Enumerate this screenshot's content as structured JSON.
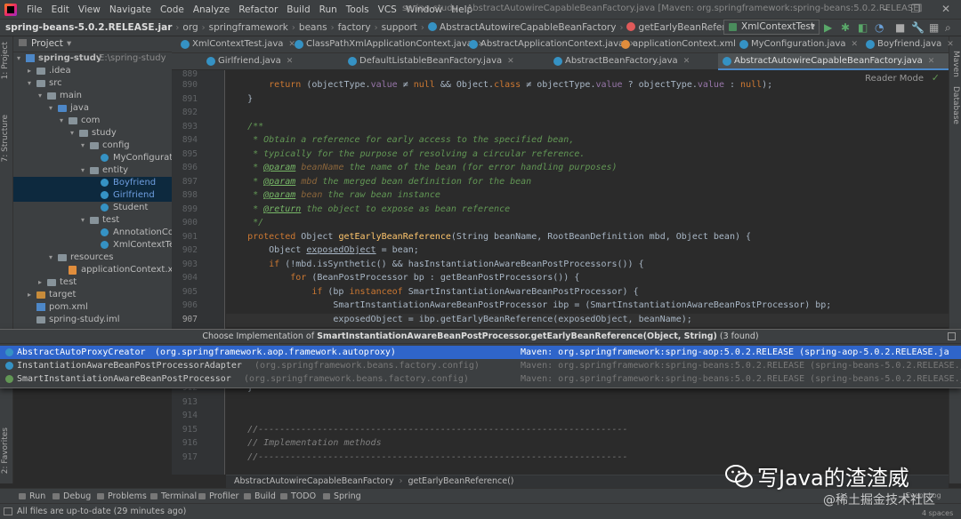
{
  "window": {
    "title": "spring-study - AbstractAutowireCapableBeanFactory.java [Maven: org.springframework:spring-beans:5.0.2.RELEASE]",
    "controls": [
      "–",
      "❐",
      "✕"
    ]
  },
  "menu": [
    "File",
    "Edit",
    "View",
    "Navigate",
    "Code",
    "Analyze",
    "Refactor",
    "Build",
    "Run",
    "Tools",
    "VCS",
    "Window",
    "Help"
  ],
  "nav_breadcrumb": {
    "jar": "spring-beans-5.0.2.RELEASE.jar",
    "parts": [
      "org",
      "springframework",
      "beans",
      "factory",
      "support"
    ],
    "class": "AbstractAutowireCapableBeanFactory",
    "method": "getEarlyBeanReference"
  },
  "run_config": "XmlContextTest",
  "project": {
    "header": "Project",
    "tree": [
      {
        "label": "spring-study",
        "path": "E:\\spring-study",
        "bold": true
      },
      {
        "label": ".idea"
      },
      {
        "label": "src"
      },
      {
        "label": "main"
      },
      {
        "label": "java"
      },
      {
        "label": "com"
      },
      {
        "label": "study"
      },
      {
        "label": "config"
      },
      {
        "label": "MyConfiguration"
      },
      {
        "label": "entity"
      },
      {
        "label": "Boyfriend"
      },
      {
        "label": "Girlfriend"
      },
      {
        "label": "Student"
      },
      {
        "label": "test"
      },
      {
        "label": "AnnotationCo"
      },
      {
        "label": "XmlContextTe"
      },
      {
        "label": "resources"
      },
      {
        "label": "applicationContext.xml"
      },
      {
        "label": "test"
      },
      {
        "label": "target"
      },
      {
        "label": "pom.xml"
      },
      {
        "label": "spring-study.iml"
      }
    ]
  },
  "side_tabs": {
    "left": [
      "1: Project",
      "7: Structure",
      "2: Favorites"
    ],
    "right": [
      "Maven",
      "Database"
    ]
  },
  "tabs_row1": [
    {
      "label": "XmlContextTest.java"
    },
    {
      "label": "ClassPathXmlApplicationContext.java"
    },
    {
      "label": "AbstractApplicationContext.java"
    },
    {
      "label": "applicationContext.xml"
    },
    {
      "label": "MyConfiguration.java"
    },
    {
      "label": "Boyfriend.java"
    }
  ],
  "tabs_row2": [
    {
      "label": "Girlfriend.java"
    },
    {
      "label": "DefaultListableBeanFactory.java"
    },
    {
      "label": "AbstractBeanFactory.java"
    },
    {
      "label": "AbstractAutowireCapableBeanFactory.java",
      "active": true
    }
  ],
  "editor": {
    "reader_mode": "Reader Mode",
    "line_numbers": [
      "889",
      "890",
      "891",
      "892",
      "893",
      "894",
      "895",
      "896",
      "897",
      "898",
      "899",
      "900",
      "901",
      "902",
      "903",
      "904",
      "905",
      "906",
      "907",
      "912",
      "913",
      "914",
      "915",
      "916",
      "917"
    ],
    "lines": [
      [],
      [
        [
          "kw",
          "        return "
        ],
        [
          "n",
          "(objectType."
        ],
        [
          "f",
          "value"
        ],
        [
          "n",
          " ≠ "
        ],
        [
          "kw",
          "null"
        ],
        [
          "n",
          " && Object."
        ],
        [
          "kw",
          "class"
        ],
        [
          "n",
          " ≠ objectType."
        ],
        [
          "f",
          "value"
        ],
        [
          "n",
          " ? objectType."
        ],
        [
          "f",
          "value"
        ],
        [
          "n",
          " : "
        ],
        [
          "kw",
          "null"
        ],
        [
          "n",
          ");"
        ]
      ],
      [
        [
          "n",
          "    }"
        ]
      ],
      [],
      [
        [
          "d",
          "    /**"
        ]
      ],
      [
        [
          "d",
          "     * Obtain a reference for early access to the specified bean,"
        ]
      ],
      [
        [
          "d",
          "     * typically for the purpose of resolving a circular reference."
        ]
      ],
      [
        [
          "d",
          "     * "
        ],
        [
          "dt",
          "@param"
        ],
        [
          "d",
          " "
        ],
        [
          "dv",
          "beanName"
        ],
        [
          "d",
          " the name of the bean (for error handling purposes)"
        ]
      ],
      [
        [
          "d",
          "     * "
        ],
        [
          "dt",
          "@param"
        ],
        [
          "d",
          " "
        ],
        [
          "dv",
          "mbd"
        ],
        [
          "d",
          " the merged bean definition for the bean"
        ]
      ],
      [
        [
          "d",
          "     * "
        ],
        [
          "dt",
          "@param"
        ],
        [
          "d",
          " "
        ],
        [
          "dv",
          "bean"
        ],
        [
          "d",
          " the raw bean instance"
        ]
      ],
      [
        [
          "d",
          "     * "
        ],
        [
          "dt",
          "@return"
        ],
        [
          "d",
          " the object to expose as bean reference"
        ]
      ],
      [
        [
          "d",
          "     */"
        ]
      ],
      [
        [
          "kw",
          "    protected "
        ],
        [
          "n",
          "Object "
        ],
        [
          "m",
          "getEarlyBeanReference"
        ],
        [
          "n",
          "(String beanName, RootBeanDefinition mbd, Object bean) {"
        ]
      ],
      [
        [
          "n",
          "        Object "
        ],
        [
          "u",
          "exposedObject"
        ],
        [
          "n",
          " = bean;"
        ]
      ],
      [
        [
          "kw",
          "        if "
        ],
        [
          "n",
          "(!mbd.isSynthetic() && hasInstantiationAwareBeanPostProcessors()) {"
        ]
      ],
      [
        [
          "kw",
          "            for "
        ],
        [
          "n",
          "(BeanPostProcessor bp : getBeanPostProcessors()) {"
        ]
      ],
      [
        [
          "kw",
          "                if "
        ],
        [
          "n",
          "(bp "
        ],
        [
          "kw",
          "instanceof "
        ],
        [
          "n",
          "SmartInstantiationAwareBeanPostProcessor) {"
        ]
      ],
      [
        [
          "n",
          "                    SmartInstantiationAwareBeanPostProcessor ibp = (SmartInstantiationAwareBeanPostProcessor) bp;"
        ]
      ],
      [
        [
          "n",
          "                    exposedObject = ibp.getEarlyBeanReference(exposedObject, beanName);"
        ]
      ],
      [
        [
          "n",
          "    }"
        ]
      ],
      [],
      [],
      [
        [
          "c",
          "    //---------------------------------------------------------------------"
        ]
      ],
      [
        [
          "c",
          "    // Implementation methods"
        ]
      ],
      [
        [
          "c",
          "    //---------------------------------------------------------------------"
        ]
      ]
    ]
  },
  "popup": {
    "title_prefix": "Choose Implementation of ",
    "title_method": "SmartInstantiationAwareBeanPostProcessor.getEarlyBeanReference(Object, String)",
    "title_suffix": " (3 found)",
    "rows": [
      {
        "name": "AbstractAutoProxyCreator",
        "pkg": "(org.springframework.aop.framework.autoproxy)",
        "maven": "Maven: org.springframework:spring-aop:5.0.2.RELEASE (spring-aop-5.0.2.RELEASE.ja",
        "selected": true
      },
      {
        "name": "InstantiationAwareBeanPostProcessorAdapter",
        "pkg": "(org.springframework.beans.factory.config)",
        "maven": "Maven: org.springframework:spring-beans:5.0.2.RELEASE (spring-beans-5.0.2.RELEASE.j"
      },
      {
        "name": "SmartInstantiationAwareBeanPostProcessor",
        "pkg": "(org.springframework.beans.factory.config)",
        "maven": "Maven: org.springframework:spring-beans:5.0.2.RELEASE (spring-beans-5.0.2.RELEASE.j"
      }
    ]
  },
  "editor_breadcrumb": [
    "AbstractAutowireCapableBeanFactory",
    "getEarlyBeanReference()"
  ],
  "tool_windows": [
    "Run",
    "Debug",
    "Problems",
    "Terminal",
    "Profiler",
    "Build",
    "TODO",
    "Spring"
  ],
  "right_status": [
    "Event Log",
    "4 spaces"
  ],
  "status": "All files are up-to-date (29 minutes ago)",
  "watermark": {
    "title": "写Java的渣渣威",
    "sub": "@稀土掘金技术社区"
  },
  "colors": {
    "keyword": "#cc7832",
    "method": "#ffc66d",
    "field": "#9876aa",
    "doc": "#629755",
    "doc_tag": "#77b767",
    "comment": "#808080",
    "selection": "#2f65ca"
  }
}
